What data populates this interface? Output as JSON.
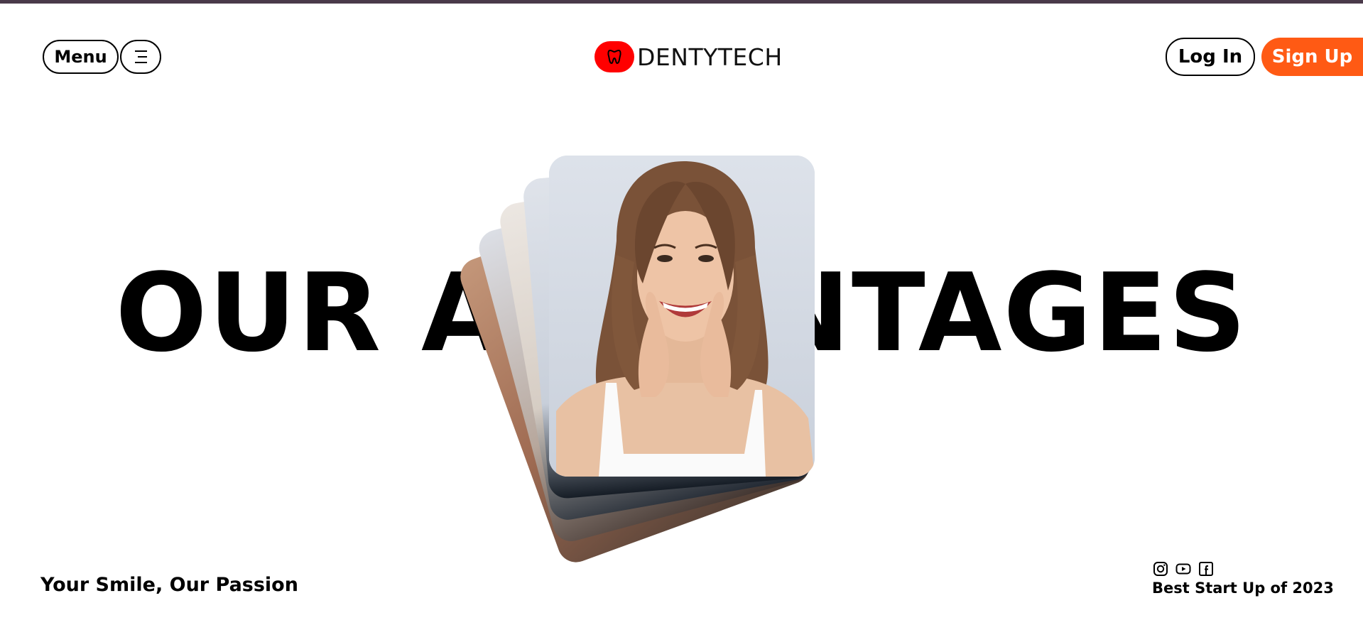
{
  "header": {
    "menu_label": "Menu",
    "menu_icon": "hamburger-icon",
    "logo": {
      "text": "DENTYTECH",
      "icon": "tooth-icon",
      "badge_color": "#ff0000"
    },
    "login_label": "Log In",
    "signup_label": "Sign Up",
    "signup_color": "#ff5a14"
  },
  "hero": {
    "headline": "OUR ADVANTAGES",
    "card_image": "smiling-woman-photo"
  },
  "footer": {
    "tagline": "Your Smile, Our Passion",
    "social_icons": [
      "instagram-icon",
      "youtube-icon",
      "facebook-icon"
    ],
    "award": "Best Start Up of 2023"
  }
}
